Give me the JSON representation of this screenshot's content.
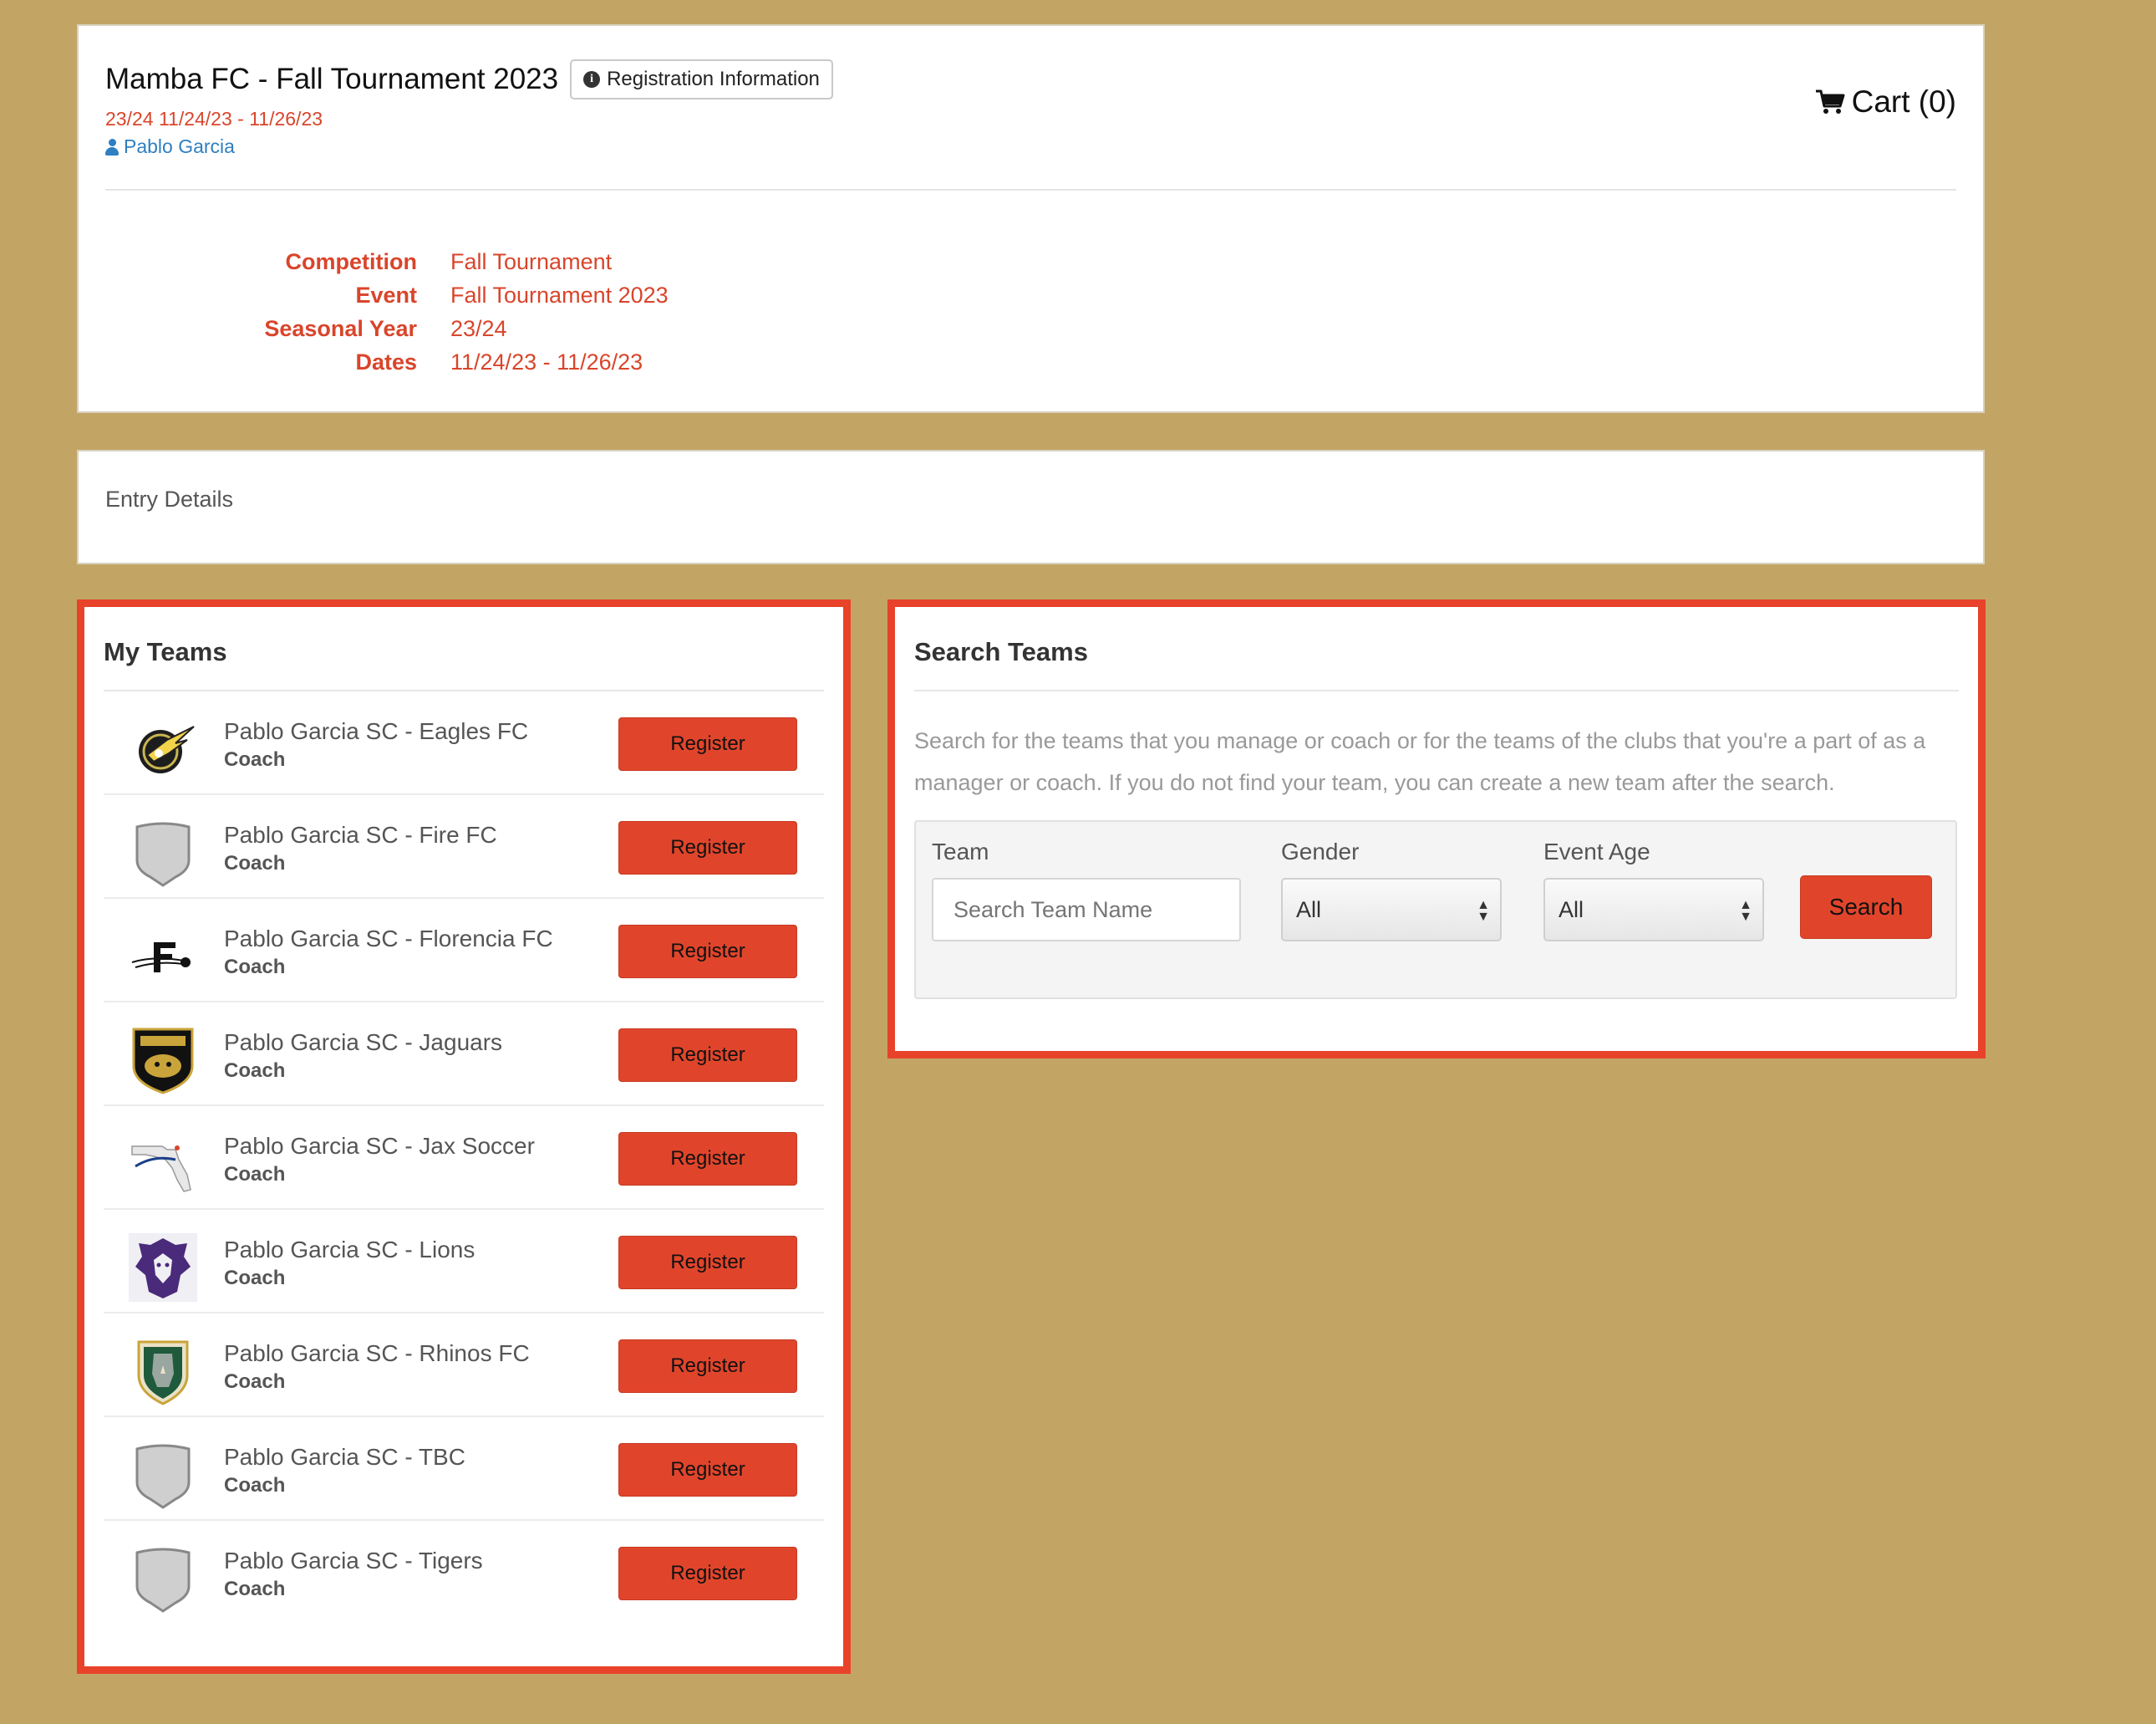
{
  "header": {
    "title": "Mamba FC - Fall Tournament 2023",
    "registration_info_label": "Registration Information",
    "subline": "23/24 11/24/23 - 11/26/23",
    "user_name": "Pablo Garcia",
    "cart_label": "Cart (0)"
  },
  "details": [
    {
      "label": "Competition",
      "value": "Fall Tournament"
    },
    {
      "label": "Event",
      "value": "Fall Tournament 2023"
    },
    {
      "label": "Seasonal Year",
      "value": "23/24"
    },
    {
      "label": "Dates",
      "value": "11/24/23 - 11/26/23"
    }
  ],
  "entry": {
    "title": "Entry Details"
  },
  "my_teams": {
    "heading": "My Teams",
    "register_label": "Register",
    "teams": [
      {
        "name": "Pablo Garcia SC - Eagles FC",
        "role": "Coach",
        "logo": "eagle-logo"
      },
      {
        "name": "Pablo Garcia SC - Fire FC",
        "role": "Coach",
        "logo": "shield-logo"
      },
      {
        "name": "Pablo Garcia SC - Florencia FC",
        "role": "Coach",
        "logo": "florencia-logo"
      },
      {
        "name": "Pablo Garcia SC - Jaguars",
        "role": "Coach",
        "logo": "jaguars-logo"
      },
      {
        "name": "Pablo Garcia SC - Jax Soccer",
        "role": "Coach",
        "logo": "jacksonville-map-logo"
      },
      {
        "name": "Pablo Garcia SC - Lions",
        "role": "Coach",
        "logo": "lion-logo"
      },
      {
        "name": "Pablo Garcia SC - Rhinos FC",
        "role": "Coach",
        "logo": "rhino-logo"
      },
      {
        "name": "Pablo Garcia SC - TBC",
        "role": "Coach",
        "logo": "shield-logo"
      },
      {
        "name": "Pablo Garcia SC - Tigers",
        "role": "Coach",
        "logo": "shield-logo"
      }
    ]
  },
  "search": {
    "heading": "Search Teams",
    "description": "Search for the teams that you manage or coach or for the teams of the clubs that you're a part of as a manager or coach. If you do not find your team, you can create a new team after the search.",
    "team_label": "Team",
    "team_placeholder": "Search Team Name",
    "gender_label": "Gender",
    "gender_value": "All",
    "age_label": "Event Age",
    "age_value": "All",
    "search_label": "Search"
  },
  "colors": {
    "background": "#c2a565",
    "accent": "#e0452b",
    "highlight_border": "#e8432a",
    "link": "#2f7fc1"
  }
}
